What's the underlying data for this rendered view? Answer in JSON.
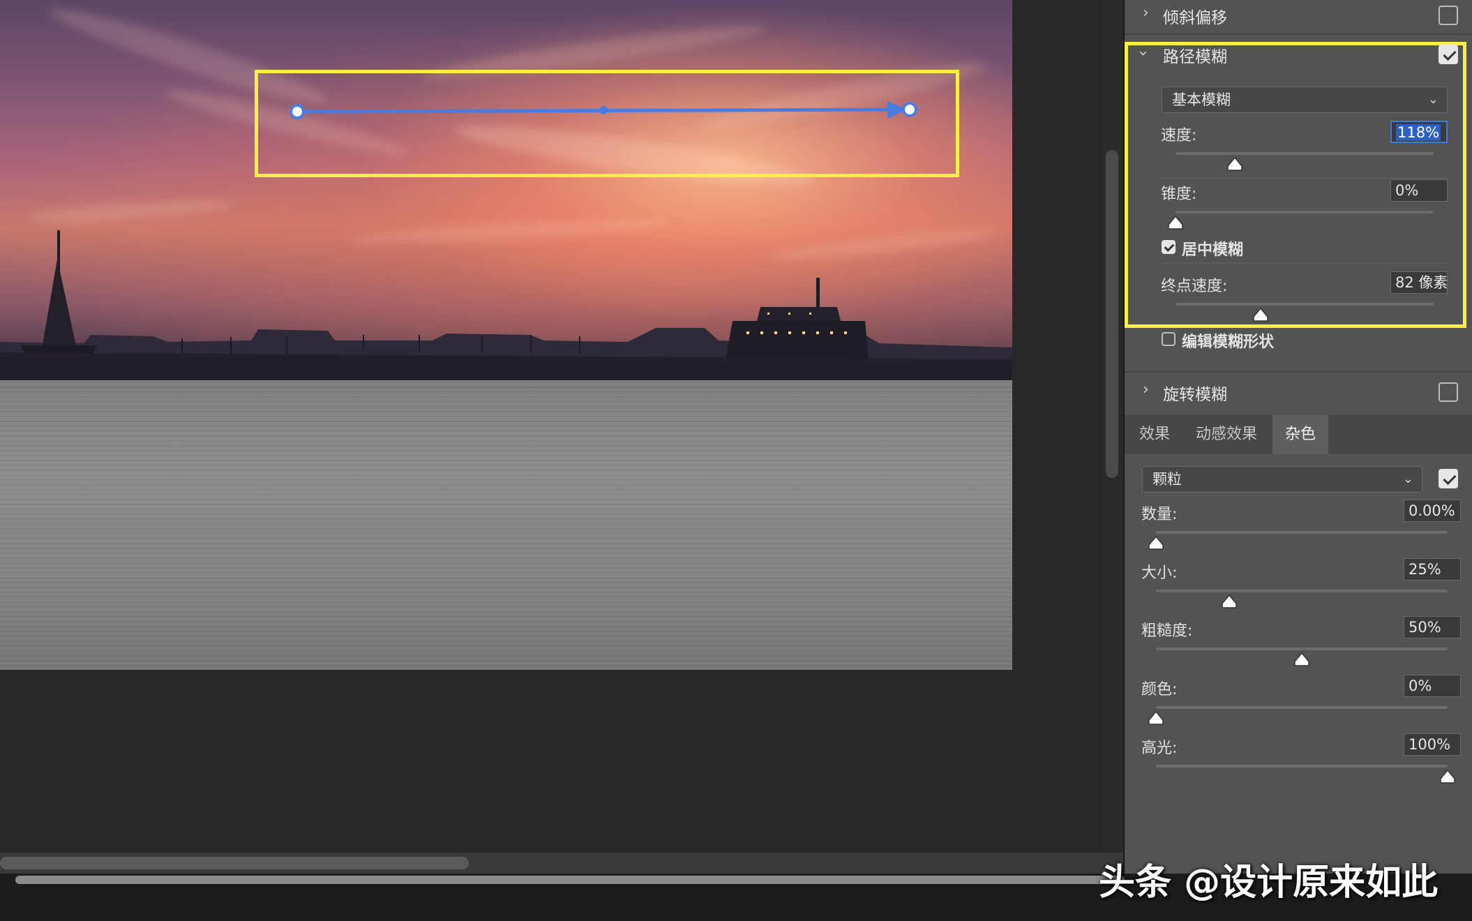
{
  "panel": {
    "tilt_shift": {
      "title": "倾斜偏移",
      "checked": false
    },
    "path_blur": {
      "title": "路径模糊",
      "checked": true,
      "mode_select": {
        "value": "基本模糊"
      },
      "speed": {
        "label": "速度:",
        "value": "118%",
        "level": 0.23
      },
      "taper": {
        "label": "锥度:",
        "value": "0%",
        "level": 0.0
      },
      "center_blur": {
        "label": "居中模糊",
        "checked": true
      },
      "end_speed": {
        "label": "终点速度:",
        "value": "82 像素",
        "level": 0.33
      },
      "edit_shape": {
        "label": "编辑模糊形状",
        "checked": false
      }
    },
    "spin_blur": {
      "title": "旋转模糊",
      "checked": false
    },
    "tabs": [
      {
        "label": "效果",
        "active": false
      },
      {
        "label": "动感效果",
        "active": false
      },
      {
        "label": "杂色",
        "active": true
      }
    ],
    "noise": {
      "type_select": {
        "value": "颗粒"
      },
      "enabled": true,
      "amount": {
        "label": "数量:",
        "value": "0.00%",
        "level": 0.0
      },
      "size": {
        "label": "大小:",
        "value": "25%",
        "level": 0.25
      },
      "roughness": {
        "label": "粗糙度:",
        "value": "50%",
        "level": 0.5
      },
      "color": {
        "label": "颜色:",
        "value": "0%",
        "level": 0.0
      },
      "highlight": {
        "label": "高光:",
        "value": "100%",
        "level": 1.0
      }
    }
  },
  "watermark": "头条 @设计原来如此",
  "colors": {
    "highlight_box": "#fbef45",
    "path_line": "#4a7be0",
    "panel_bg": "#535353",
    "canvas_bg": "#282828"
  },
  "icons": {
    "collapsed": "chevron-right-icon",
    "expanded": "chevron-down-icon",
    "dropdown": "chevron-down-icon",
    "slider": "triangle-thumb-icon"
  }
}
